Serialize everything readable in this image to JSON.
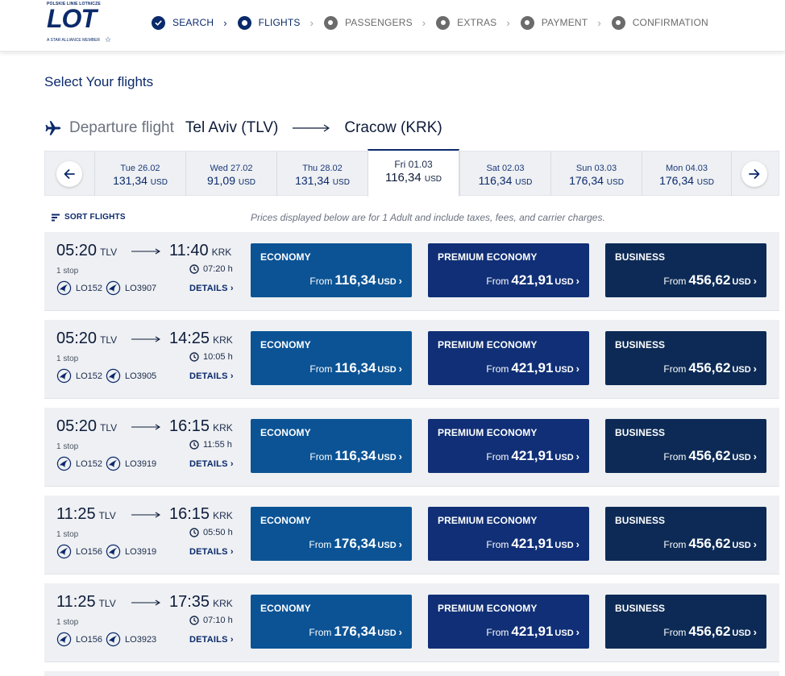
{
  "logo": {
    "top_text": "POLSKIE LINIE LOTNICZE",
    "main_text": "LOT",
    "sub_text": "A STAR ALLIANCE MEMBER"
  },
  "steps": [
    {
      "label": "SEARCH",
      "state": "done"
    },
    {
      "label": "FLIGHTS",
      "state": "active"
    },
    {
      "label": "PASSENGERS",
      "state": "todo"
    },
    {
      "label": "EXTRAS",
      "state": "todo"
    },
    {
      "label": "PAYMENT",
      "state": "todo"
    },
    {
      "label": "CONFIRMATION",
      "state": "todo"
    }
  ],
  "page_title": "Select Your flights",
  "departure": {
    "label": "Departure flight",
    "from": "Tel Aviv (TLV)",
    "to": "Cracow (KRK)"
  },
  "dates": [
    {
      "day": "Tue 26.02",
      "amount": "131,34",
      "currency": "USD"
    },
    {
      "day": "Wed 27.02",
      "amount": "91,09",
      "currency": "USD"
    },
    {
      "day": "Thu 28.02",
      "amount": "131,34",
      "currency": "USD"
    },
    {
      "day": "Fri 01.03",
      "amount": "116,34",
      "currency": "USD",
      "selected": true
    },
    {
      "day": "Sat 02.03",
      "amount": "116,34",
      "currency": "USD"
    },
    {
      "day": "Sun 03.03",
      "amount": "176,34",
      "currency": "USD"
    },
    {
      "day": "Mon 04.03",
      "amount": "176,34",
      "currency": "USD"
    }
  ],
  "sort_label": "SORT FLIGHTS",
  "price_note": "Prices displayed below are for 1 Adult and include taxes, fees, and carrier charges.",
  "fare_labels": {
    "economy": "ECONOMY",
    "premium": "PREMIUM ECONOMY",
    "business": "BUSINESS",
    "from": "From",
    "currency": "USD"
  },
  "details_label": "DETAILS",
  "flights": [
    {
      "dep_time": "05:20",
      "dep_code": "TLV",
      "arr_time": "11:40",
      "arr_code": "KRK",
      "stops": "1 stop",
      "duration": "07:20 h",
      "flight1": "LO152",
      "flight2": "LO3907",
      "economy": "116,34",
      "premium": "421,91",
      "business": "456,62"
    },
    {
      "dep_time": "05:20",
      "dep_code": "TLV",
      "arr_time": "14:25",
      "arr_code": "KRK",
      "stops": "1 stop",
      "duration": "10:05 h",
      "flight1": "LO152",
      "flight2": "LO3905",
      "economy": "116,34",
      "premium": "421,91",
      "business": "456,62"
    },
    {
      "dep_time": "05:20",
      "dep_code": "TLV",
      "arr_time": "16:15",
      "arr_code": "KRK",
      "stops": "1 stop",
      "duration": "11:55 h",
      "flight1": "LO152",
      "flight2": "LO3919",
      "economy": "116,34",
      "premium": "421,91",
      "business": "456,62"
    },
    {
      "dep_time": "11:25",
      "dep_code": "TLV",
      "arr_time": "16:15",
      "arr_code": "KRK",
      "stops": "1 stop",
      "duration": "05:50 h",
      "flight1": "LO156",
      "flight2": "LO3919",
      "economy": "176,34",
      "premium": "421,91",
      "business": "456,62"
    },
    {
      "dep_time": "11:25",
      "dep_code": "TLV",
      "arr_time": "17:35",
      "arr_code": "KRK",
      "stops": "1 stop",
      "duration": "07:10 h",
      "flight1": "LO156",
      "flight2": "LO3923",
      "economy": "176,34",
      "premium": "421,91",
      "business": "456,62"
    }
  ]
}
